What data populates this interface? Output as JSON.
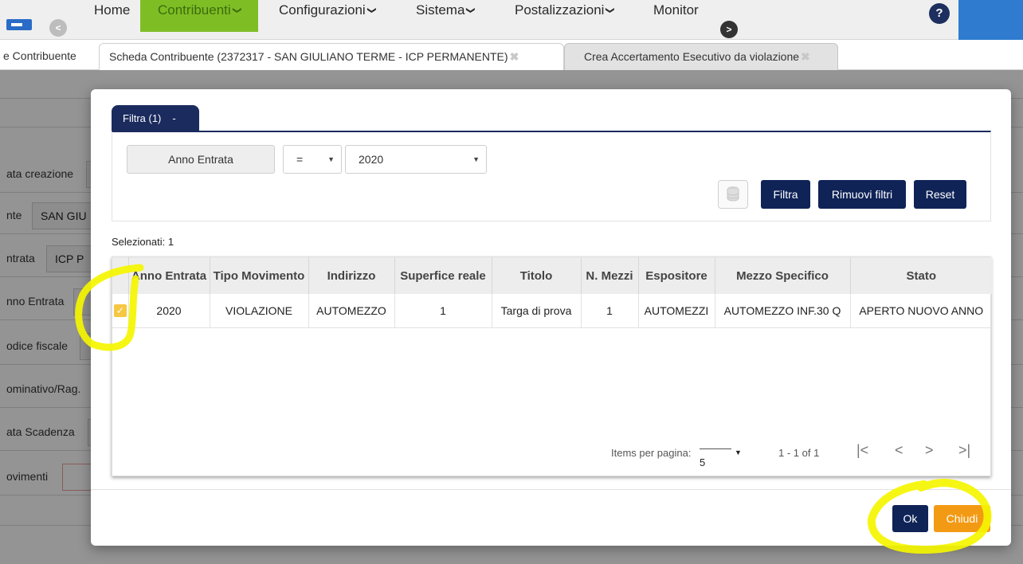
{
  "nav": {
    "items": [
      {
        "label": "Home",
        "chevron": ""
      },
      {
        "label": "Contribuenti",
        "chevron": "❯"
      },
      {
        "label": "Configurazioni",
        "chevron": "❯"
      },
      {
        "label": "Sistema",
        "chevron": "❯"
      },
      {
        "label": "Postalizzazioni",
        "chevron": "❯"
      },
      {
        "label": "Monitor",
        "chevron": ""
      }
    ],
    "back_glyph": "<",
    "forward_glyph": ">",
    "help_glyph": "?",
    "colors": {
      "active": "#7fbd25",
      "bar": "#efefef",
      "corner": "#2e7bcf"
    }
  },
  "tabs": [
    {
      "label": "e Contribuente"
    },
    {
      "label": "Scheda Contribuente (2372317 - SAN GIULIANO TERME - ICP PERMANENTE)",
      "close": "✖"
    },
    {
      "label": "Crea Accertamento Esecutivo da violazione",
      "close": "✖"
    }
  ],
  "background_form": {
    "rows": [
      {
        "label": "ata creazione",
        "value": ""
      },
      {
        "label": "nte",
        "value": "SAN GIU"
      },
      {
        "label": "ntrata",
        "value": "ICP P"
      },
      {
        "label": "nno Entrata",
        "value": ""
      },
      {
        "label": "odice fiscale",
        "value": ""
      },
      {
        "label": "ominativo/Rag.",
        "value": ""
      },
      {
        "label": "ata Scadenza",
        "value": ""
      },
      {
        "label": "ovimenti",
        "value": ""
      }
    ]
  },
  "modal": {
    "filter_tab": {
      "label": "Filtra (1)",
      "toggle": "-"
    },
    "filter": {
      "field": "Anno Entrata",
      "operator": "=",
      "value": "2020",
      "caret": "▼"
    },
    "buttons": {
      "filter": "Filtra",
      "remove_filters": "Rimuovi filtri",
      "reset": "Reset",
      "db_icon": "database-icon"
    },
    "selected_label": "Selezionati: 1",
    "table": {
      "columns": [
        "",
        "Anno Entrata",
        "Tipo Movimento",
        "Indirizzo",
        "Superfice reale",
        "Titolo",
        "N. Mezzi",
        "Espositore",
        "Mezzo Specifico",
        "Stato"
      ],
      "rows": [
        {
          "checked": "✓",
          "cells": [
            "2020",
            "VIOLAZIONE",
            "AUTOMEZZO",
            "1",
            "Targa di prova",
            "1",
            "AUTOMEZZI",
            "AUTOMEZZO INF.30 Q",
            "APERTO NUOVO ANNO"
          ]
        }
      ]
    },
    "pager": {
      "items_label": "Items per pagina:",
      "page_size": "5",
      "range": "1 - 1 of 1",
      "first": "|<",
      "prev": "<",
      "next": ">",
      "last": ">|"
    },
    "ok_label": "Ok",
    "close_label": "Chiudi",
    "colors": {
      "navy": "#0f2357",
      "orange": "#f39a14",
      "checkbox": "#f7c743",
      "highlight": "#f5f500"
    }
  }
}
